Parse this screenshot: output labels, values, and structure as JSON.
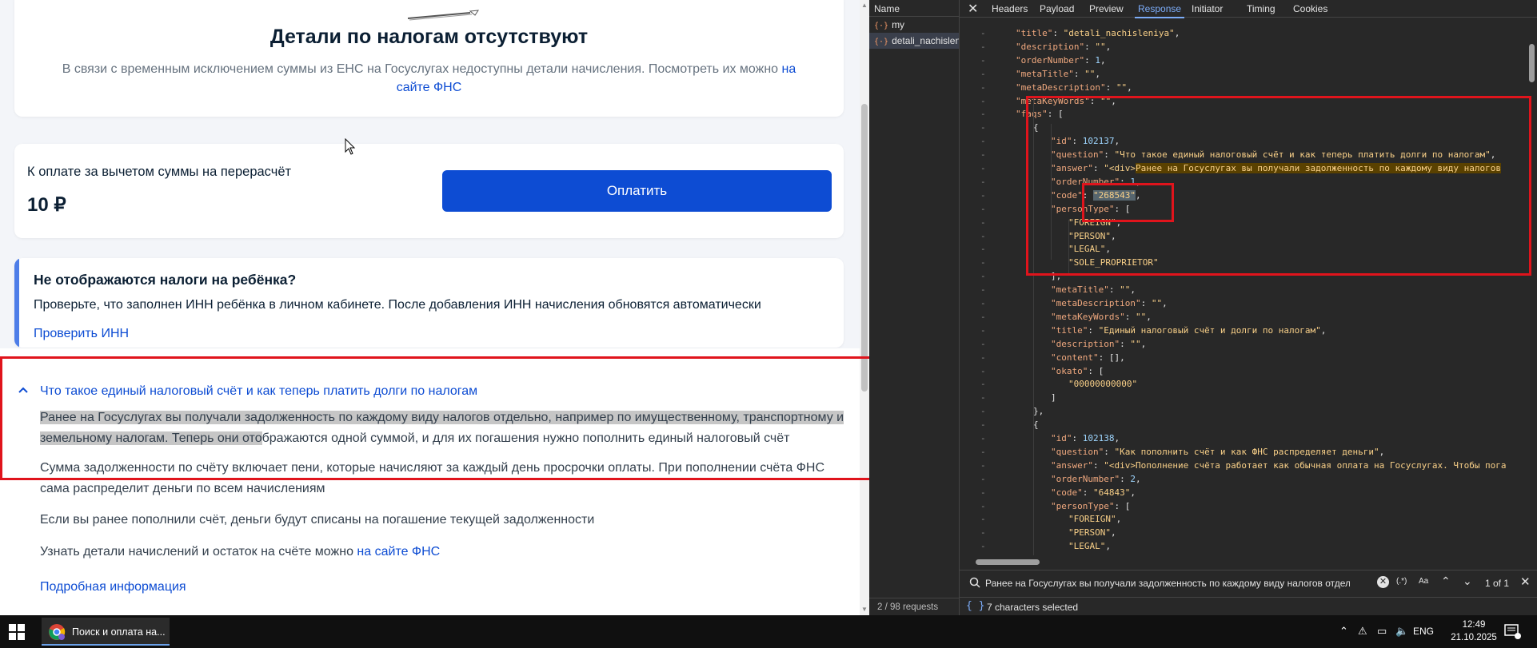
{
  "page": {
    "empty_title": "Детали по налогам отсутствуют",
    "empty_text": "В связи с временным исключением суммы из ЕНС на Госуслугах недоступны детали начисления. Посмотреть их можно",
    "empty_link": "на сайте ФНС",
    "pay_label": "К оплате за вычетом суммы на перерасчёт",
    "pay_amount": "10 ₽",
    "pay_button": "Оплатить",
    "info_title": "Не отображаются налоги на ребёнка?",
    "info_text": "Проверьте, что заполнен ИНН ребёнка в личном кабинете. После добавления ИНН начисления обновятся автоматически",
    "info_link": "Проверить ИНН",
    "faq_question": "Что такое единый налоговый счёт и как теперь платить долги по налогам",
    "faq_p1_highlight": "Ранее на Госуслугах вы получали задолженность по каждому виду налогов отдельно, например по имущественному, транспортному и земельному налогам. Теперь они ото",
    "faq_p1_rest": "бражаются одной суммой, и для их погашения нужно пополнить единый налоговый счёт",
    "faq_p2": "Сумма задолженности по счёту включает пени, которые начисляют за каждый день просрочки оплаты. При пополнении счёта ФНС сама распределит деньги по всем начислениям",
    "faq_p3": "Если вы ранее пополнили счёт, деньги будут списаны на погашение текущей задолженности",
    "faq_p4_text": "Узнать детали начислений и остаток на счёте можно",
    "faq_p4_link": "на сайте ФНС",
    "faq_more": "Подробная информация"
  },
  "devtools": {
    "name_header": "Name",
    "requests": [
      "my",
      "detali_nachislen"
    ],
    "tabs": [
      "Headers",
      "Payload",
      "Preview",
      "Response",
      "Initiator",
      "Timing",
      "Cookies"
    ],
    "active_tab": "Response",
    "code_lines": [
      {
        "i": 0,
        "g": "-",
        "t": [
          [
            "k",
            "\"title\""
          ],
          [
            "p",
            ": "
          ],
          [
            "s",
            "\"detali_nachisleniya\""
          ],
          [
            "p",
            ","
          ]
        ]
      },
      {
        "i": 0,
        "g": "-",
        "t": [
          [
            "k",
            "\"description\""
          ],
          [
            "p",
            ": "
          ],
          [
            "s",
            "\"\""
          ],
          [
            "p",
            ","
          ]
        ]
      },
      {
        "i": 0,
        "g": "-",
        "t": [
          [
            "k",
            "\"orderNumber\""
          ],
          [
            "p",
            ": "
          ],
          [
            "n",
            "1"
          ],
          [
            "p",
            ","
          ]
        ]
      },
      {
        "i": 0,
        "g": "-",
        "t": [
          [
            "k",
            "\"metaTitle\""
          ],
          [
            "p",
            ": "
          ],
          [
            "s",
            "\"\""
          ],
          [
            "p",
            ","
          ]
        ]
      },
      {
        "i": 0,
        "g": "-",
        "t": [
          [
            "k",
            "\"metaDescription\""
          ],
          [
            "p",
            ": "
          ],
          [
            "s",
            "\"\""
          ],
          [
            "p",
            ","
          ]
        ]
      },
      {
        "i": 0,
        "g": "-",
        "t": [
          [
            "k",
            "\"metaKeyWords\""
          ],
          [
            "p",
            ": "
          ],
          [
            "s",
            "\"\""
          ],
          [
            "p",
            ","
          ]
        ]
      },
      {
        "i": 0,
        "g": "-",
        "t": [
          [
            "k",
            "\"faqs\""
          ],
          [
            "p",
            ": ["
          ]
        ]
      },
      {
        "i": 1,
        "g": "-",
        "t": [
          [
            "p",
            "{"
          ]
        ]
      },
      {
        "i": 2,
        "g": "-",
        "t": [
          [
            "k",
            "\"id\""
          ],
          [
            "p",
            ": "
          ],
          [
            "n",
            "102137"
          ],
          [
            "p",
            ","
          ]
        ]
      },
      {
        "i": 2,
        "g": "-",
        "t": [
          [
            "k",
            "\"question\""
          ],
          [
            "p",
            ": "
          ],
          [
            "s",
            "\"Что такое единый налоговый счёт и как теперь платить долги по налогам\""
          ],
          [
            "p",
            ","
          ]
        ]
      },
      {
        "i": 2,
        "g": "-",
        "t": [
          [
            "k",
            "\"answer\""
          ],
          [
            "p",
            ": "
          ],
          [
            "s",
            "\"<div>"
          ],
          [
            "h",
            "Ранее на Госуслугах вы получали задолженность по каждому виду налогов"
          ]
        ]
      },
      {
        "i": 2,
        "g": "-",
        "t": [
          [
            "k",
            "\"orderNumber\""
          ],
          [
            "p",
            ": "
          ],
          [
            "n",
            "1"
          ],
          [
            "p",
            ","
          ]
        ]
      },
      {
        "i": 2,
        "g": "-",
        "t": [
          [
            "k",
            "\"code\""
          ],
          [
            "p",
            ": "
          ],
          [
            "sel",
            "\"268543\""
          ],
          [
            "p",
            ","
          ]
        ]
      },
      {
        "i": 2,
        "g": "-",
        "t": [
          [
            "k",
            "\"personType\""
          ],
          [
            "p",
            ": ["
          ]
        ]
      },
      {
        "i": 3,
        "g": "-",
        "t": [
          [
            "s",
            "\"FOREIGN\""
          ],
          [
            "p",
            ","
          ]
        ]
      },
      {
        "i": 3,
        "g": "-",
        "t": [
          [
            "s",
            "\"PERSON\""
          ],
          [
            "p",
            ","
          ]
        ]
      },
      {
        "i": 3,
        "g": "-",
        "t": [
          [
            "s",
            "\"LEGAL\""
          ],
          [
            "p",
            ","
          ]
        ]
      },
      {
        "i": 3,
        "g": "-",
        "t": [
          [
            "s",
            "\"SOLE_PROPRIETOR\""
          ]
        ]
      },
      {
        "i": 2,
        "g": "-",
        "t": [
          [
            "p",
            "],"
          ]
        ]
      },
      {
        "i": 2,
        "g": "-",
        "t": [
          [
            "k",
            "\"metaTitle\""
          ],
          [
            "p",
            ": "
          ],
          [
            "s",
            "\"\""
          ],
          [
            "p",
            ","
          ]
        ]
      },
      {
        "i": 2,
        "g": "-",
        "t": [
          [
            "k",
            "\"metaDescription\""
          ],
          [
            "p",
            ": "
          ],
          [
            "s",
            "\"\""
          ],
          [
            "p",
            ","
          ]
        ]
      },
      {
        "i": 2,
        "g": "-",
        "t": [
          [
            "k",
            "\"metaKeyWords\""
          ],
          [
            "p",
            ": "
          ],
          [
            "s",
            "\"\""
          ],
          [
            "p",
            ","
          ]
        ]
      },
      {
        "i": 2,
        "g": "-",
        "t": [
          [
            "k",
            "\"title\""
          ],
          [
            "p",
            ": "
          ],
          [
            "s",
            "\"Единый налоговый счёт и долги по налогам\""
          ],
          [
            "p",
            ","
          ]
        ]
      },
      {
        "i": 2,
        "g": "-",
        "t": [
          [
            "k",
            "\"description\""
          ],
          [
            "p",
            ": "
          ],
          [
            "s",
            "\"\""
          ],
          [
            "p",
            ","
          ]
        ]
      },
      {
        "i": 2,
        "g": "-",
        "t": [
          [
            "k",
            "\"content\""
          ],
          [
            "p",
            ": [],"
          ]
        ]
      },
      {
        "i": 2,
        "g": "-",
        "t": [
          [
            "k",
            "\"okato\""
          ],
          [
            "p",
            ": ["
          ]
        ]
      },
      {
        "i": 3,
        "g": "-",
        "t": [
          [
            "s",
            "\"00000000000\""
          ]
        ]
      },
      {
        "i": 2,
        "g": "-",
        "t": [
          [
            "p",
            "]"
          ]
        ]
      },
      {
        "i": 1,
        "g": "-",
        "t": [
          [
            "p",
            "},"
          ]
        ]
      },
      {
        "i": 1,
        "g": "-",
        "t": [
          [
            "p",
            "{"
          ]
        ]
      },
      {
        "i": 2,
        "g": "-",
        "t": [
          [
            "k",
            "\"id\""
          ],
          [
            "p",
            ": "
          ],
          [
            "n",
            "102138"
          ],
          [
            "p",
            ","
          ]
        ]
      },
      {
        "i": 2,
        "g": "-",
        "t": [
          [
            "k",
            "\"question\""
          ],
          [
            "p",
            ": "
          ],
          [
            "s",
            "\"Как пополнить счёт и как ФНС распределяет деньги\""
          ],
          [
            "p",
            ","
          ]
        ]
      },
      {
        "i": 2,
        "g": "-",
        "t": [
          [
            "k",
            "\"answer\""
          ],
          [
            "p",
            ": "
          ],
          [
            "s",
            "\"<div>Пополнение счёта работает как обычная оплата на Госуслугах. Чтобы пога"
          ]
        ]
      },
      {
        "i": 2,
        "g": "-",
        "t": [
          [
            "k",
            "\"orderNumber\""
          ],
          [
            "p",
            ": "
          ],
          [
            "n",
            "2"
          ],
          [
            "p",
            ","
          ]
        ]
      },
      {
        "i": 2,
        "g": "-",
        "t": [
          [
            "k",
            "\"code\""
          ],
          [
            "p",
            ": "
          ],
          [
            "s",
            "\"64843\""
          ],
          [
            "p",
            ","
          ]
        ]
      },
      {
        "i": 2,
        "g": "-",
        "t": [
          [
            "k",
            "\"personType\""
          ],
          [
            "p",
            ": ["
          ]
        ]
      },
      {
        "i": 3,
        "g": "-",
        "t": [
          [
            "s",
            "\"FOREIGN\""
          ],
          [
            "p",
            ","
          ]
        ]
      },
      {
        "i": 3,
        "g": "-",
        "t": [
          [
            "s",
            "\"PERSON\""
          ],
          [
            "p",
            ","
          ]
        ]
      },
      {
        "i": 3,
        "g": "-",
        "t": [
          [
            "s",
            "\"LEGAL\""
          ],
          [
            "p",
            ","
          ]
        ]
      },
      {
        "i": 3,
        "g": "-",
        "t": []
      }
    ],
    "search_value": "Ранее на Госуслугах вы получали задолженность по каждому виду налогов отдельно, н",
    "search_regex": "(.*)",
    "search_case": "Aa",
    "search_count": "1 of 1",
    "requests_count": "2 / 98 requests",
    "status_braces": "{ }",
    "status_text": "7 characters selected"
  },
  "taskbar": {
    "app_title": "Поиск и оплата на...",
    "lang": "ENG",
    "time": "12:49",
    "date": "21.10.2025"
  },
  "colors": {
    "accent": "#0d4cd3",
    "annotation_red": "#e0141c",
    "devtools_bg": "#282828"
  }
}
